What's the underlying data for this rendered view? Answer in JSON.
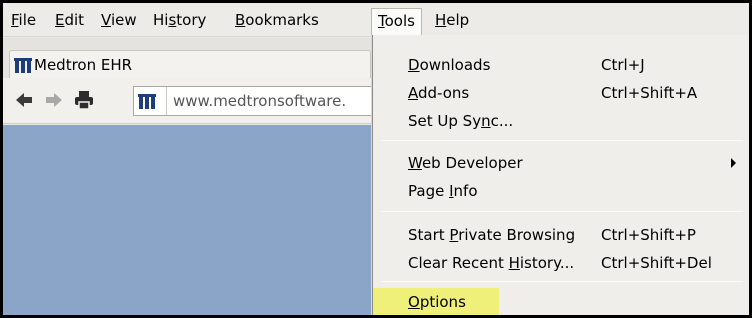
{
  "menubar": {
    "items": [
      {
        "label": "File",
        "accel": "F",
        "rest": "ile"
      },
      {
        "label": "Edit",
        "accel": "E",
        "rest": "dit"
      },
      {
        "label": "View",
        "accel": "V",
        "rest": "iew"
      },
      {
        "label": "History",
        "pre": "Hi",
        "accel": "s",
        "rest": "tory"
      },
      {
        "label": "Bookmarks",
        "accel": "B",
        "rest": "ookmarks"
      },
      {
        "label": "Tools",
        "accel": "T",
        "rest": "ools"
      },
      {
        "label": "Help",
        "accel": "H",
        "rest": "elp"
      }
    ],
    "active": "Tools"
  },
  "tab": {
    "title": "Medtron EHR",
    "icon": "medtron-logo-icon"
  },
  "navbar": {
    "back_icon": "back-arrow-icon",
    "forward_icon": "forward-arrow-icon",
    "print_icon": "printer-icon",
    "url": "www.medtronsoftware."
  },
  "tools_menu": {
    "items": [
      {
        "pre": "",
        "accel": "D",
        "rest": "ownloads",
        "shortcut": "Ctrl+J"
      },
      {
        "pre": "",
        "accel": "A",
        "rest": "dd-ons",
        "shortcut": "Ctrl+Shift+A"
      },
      {
        "pre": "Set Up Sy",
        "accel": "n",
        "rest": "c...",
        "shortcut": ""
      },
      {
        "pre": "",
        "accel": "W",
        "rest": "eb Developer",
        "shortcut": "",
        "submenu": true
      },
      {
        "pre": "Page ",
        "accel": "I",
        "rest": "nfo",
        "shortcut": ""
      },
      {
        "pre": "Start ",
        "accel": "P",
        "rest": "rivate Browsing",
        "shortcut": "Ctrl+Shift+P"
      },
      {
        "pre": "Clear Recent ",
        "accel": "H",
        "rest": "istory...",
        "shortcut": "Ctrl+Shift+Del"
      },
      {
        "pre": "",
        "accel": "O",
        "rest": "ptions",
        "shortcut": "",
        "highlighted": true
      }
    ]
  },
  "colors": {
    "highlight": "#eef07a",
    "page_background": "#8aa5c7",
    "logo": "#1f3d7a"
  }
}
